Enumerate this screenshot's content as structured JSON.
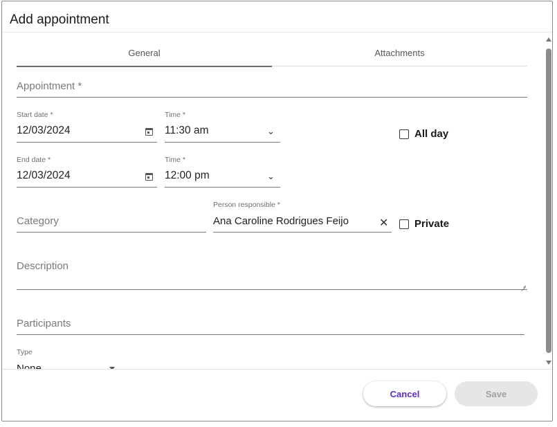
{
  "dialog": {
    "title": "Add appointment"
  },
  "tabs": [
    {
      "label": "General",
      "active": true
    },
    {
      "label": "Attachments",
      "active": false
    }
  ],
  "form": {
    "appointment_placeholder": "Appointment *",
    "start_date": {
      "label": "Start date *",
      "value": "12/03/2024"
    },
    "start_time": {
      "label": "Time *",
      "value": "11:30 am"
    },
    "all_day": {
      "label": "All day",
      "checked": false
    },
    "end_date": {
      "label": "End date *",
      "value": "12/03/2024"
    },
    "end_time": {
      "label": "Time *",
      "value": "12:00 pm"
    },
    "category_placeholder": "Category",
    "person_responsible": {
      "label": "Person responsible *",
      "value": "Ana Caroline Rodrigues Feijo",
      "clear_icon": "close-icon"
    },
    "private": {
      "label": "Private",
      "checked": false
    },
    "description_placeholder": "Description",
    "participants_placeholder": "Participants",
    "type": {
      "label": "Type",
      "value": "None"
    }
  },
  "footer": {
    "cancel_label": "Cancel",
    "save_label": "Save"
  },
  "colors": {
    "accent": "#5b2bd6",
    "disabled_bg": "#e6e6e6",
    "disabled_text": "#a0a0a0"
  }
}
